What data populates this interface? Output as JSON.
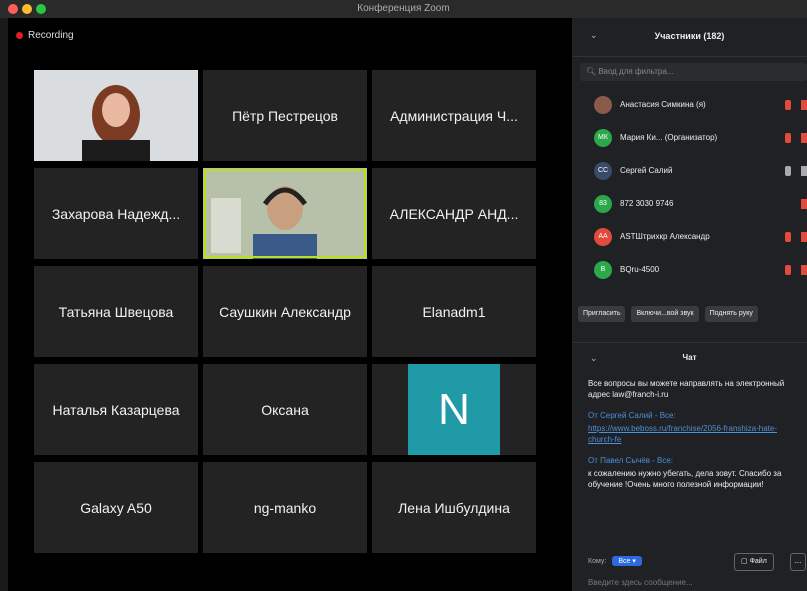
{
  "window": {
    "title": "Конференция Zoom"
  },
  "recording": {
    "label": "Recording"
  },
  "tiles": [
    {
      "name": "",
      "type": "video"
    },
    {
      "name": "Пётр Пестрецов"
    },
    {
      "name": "Администрация Ч..."
    },
    {
      "name": "Захарова Надежд..."
    },
    {
      "name": "",
      "type": "video-active"
    },
    {
      "name": "АЛЕКСАНДР АНД..."
    },
    {
      "name": "Татьяна Швецова"
    },
    {
      "name": "Саушкин Александр"
    },
    {
      "name": "Elanadm1"
    },
    {
      "name": "Наталья Казарцева"
    },
    {
      "name": "Оксана"
    },
    {
      "name": "",
      "letter": "N"
    },
    {
      "name": "Galaxy A50"
    },
    {
      "name": "ng-manko"
    },
    {
      "name": "Лена Ишбулдина"
    }
  ],
  "participants": {
    "title": "Участники (182)",
    "search_placeholder": "Ввод для фильтра...",
    "items": [
      {
        "initials": "",
        "label": "Анастасия Симкина (я)",
        "color": "#8a5a4a"
      },
      {
        "initials": "МК",
        "label": "Мария Ки... (Организатор)",
        "color": "#2aa84a"
      },
      {
        "initials": "СС",
        "label": "Сергей Салий",
        "color": "#3a4a6a"
      },
      {
        "initials": "83",
        "label": "872 3030 9746",
        "color": "#2aa84a"
      },
      {
        "initials": "АА",
        "label": "ASTШтрихкр Александр",
        "color": "#e24a3b"
      },
      {
        "initials": "В",
        "label": "BQru-4500",
        "color": "#2aa84a"
      }
    ],
    "buttons": [
      "Пригласить",
      "Включи...вой звук",
      "Поднять руку"
    ]
  },
  "chat": {
    "title": "Чат",
    "messages": [
      {
        "from": "",
        "text": "Все вопросы вы можете направлять на электронный адрес law@franch-i.ru"
      },
      {
        "from": "От Сергей Салий - Все:",
        "link": "https://www.beboss.ru/franchise/2056-franshiza-hate-church-fe"
      },
      {
        "from": "От Павел Сычёв - Все:",
        "text": "к сожалению нужно убегать, дела зовут. Спасибо за обучение !Очень много полезной информации!"
      }
    ],
    "to_label": "Кому:",
    "to_value": "Все",
    "file_button": "Файл",
    "more_button": "...",
    "input_placeholder": "Введите здесь сообщение..."
  }
}
